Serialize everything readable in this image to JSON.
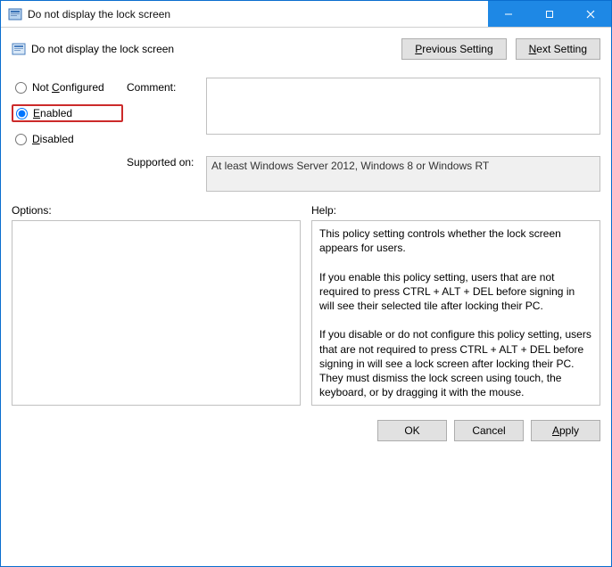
{
  "window": {
    "title": "Do not display the lock screen",
    "controls": {
      "minimize": "minimize-icon",
      "maximize": "maximize-icon",
      "close": "close-icon"
    }
  },
  "header": {
    "setting_name": "Do not display the lock screen",
    "prev_label": "Previous Setting",
    "next_label": "Next Setting"
  },
  "state": {
    "options": {
      "not_configured_label": "Not Configured",
      "enabled_label": "Enabled",
      "disabled_label": "Disabled",
      "selected": "enabled"
    }
  },
  "labels": {
    "comment": "Comment:",
    "supported_on": "Supported on:",
    "options": "Options:",
    "help": "Help:"
  },
  "fields": {
    "comment_value": "",
    "supported_on_value": "At least Windows Server 2012, Windows 8 or Windows RT"
  },
  "options_panel": "",
  "help_panel": "This policy setting controls whether the lock screen appears for users.\n\nIf you enable this policy setting, users that are not required to press CTRL + ALT + DEL before signing in will see their selected tile after locking their PC.\n\nIf you disable or do not configure this policy setting, users that are not required to press CTRL + ALT + DEL before signing in will see a lock screen after locking their PC. They must dismiss the lock screen using touch, the keyboard, or by dragging it with the mouse.",
  "footer": {
    "ok": "OK",
    "cancel": "Cancel",
    "apply": "Apply"
  }
}
